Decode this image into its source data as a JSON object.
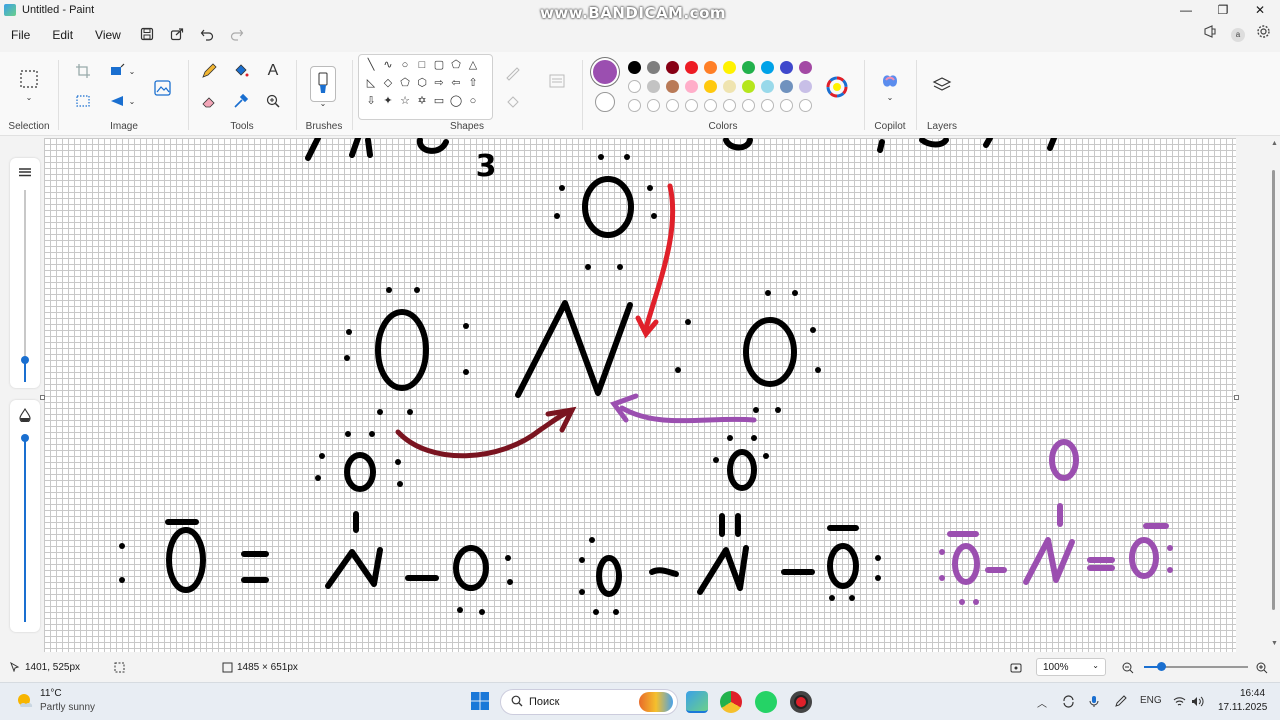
{
  "window": {
    "title": "Untitled - Paint",
    "watermark": "www.BANDICAM.com",
    "minimize": "—",
    "maximize": "❐",
    "close": "✕"
  },
  "menu": {
    "file": "File",
    "edit": "Edit",
    "view": "View",
    "profile_badge": "a"
  },
  "ribbon": {
    "selection_label": "Selection",
    "image_label": "Image",
    "tools_label": "Tools",
    "brushes_label": "Brushes",
    "shapes_label": "Shapes",
    "colors_label": "Colors",
    "copilot_label": "Copilot",
    "layers_label": "Layers",
    "text_tool": "A",
    "color1": "#9b4fb0",
    "color2": "#ffffff",
    "palette_row1": [
      "#000000",
      "#7f7f7f",
      "#880015",
      "#ed1c24",
      "#ff7f27",
      "#fff200",
      "#22b14c",
      "#00a2e8",
      "#3f48cc",
      "#a349a4"
    ],
    "palette_row2": [
      "#ffffff",
      "#c3c3c3",
      "#b97a57",
      "#ffaec9",
      "#ffc90e",
      "#efe4b0",
      "#b5e61d",
      "#99d9ea",
      "#7092be",
      "#c8bfe7"
    ]
  },
  "drawing": {
    "labels": {
      "subscript_3": "3",
      "central_n": "N",
      "o_top": "O",
      "o_left": "O",
      "o_right": "O",
      "o_bottom_left": "O",
      "o_bottom_right": "O",
      "res1": [
        ":",
        "O",
        "=",
        "N",
        "–",
        "O",
        ":"
      ],
      "res2": [
        ":",
        "O",
        "–",
        "N",
        "–",
        "O",
        ":"
      ],
      "res3": [
        ":",
        "O",
        "–",
        "N",
        "=",
        "O",
        ":"
      ],
      "res3_top": "O"
    },
    "ink_black": "#000000",
    "ink_red": "#e0202a",
    "ink_darkred": "#7a1420",
    "ink_purple": "#9b4fb0"
  },
  "status": {
    "cursor_pos": "1401, 525px",
    "canvas_size": "1485 × 651px",
    "zoom": "100%"
  },
  "taskbar": {
    "weather_temp": "11°C",
    "weather_desc": "Partly sunny",
    "search_placeholder": "Поиск",
    "lang": "ENG",
    "time": "16:44",
    "date": "17.11.2025"
  }
}
